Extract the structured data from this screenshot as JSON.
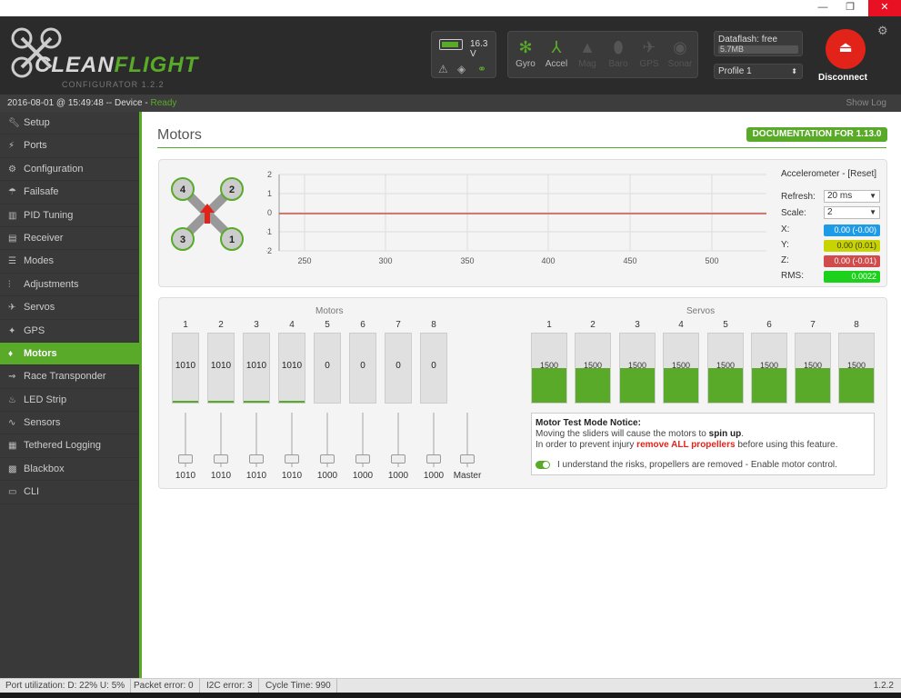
{
  "window": {
    "minimize": "—",
    "restore": "❐",
    "close": "✕"
  },
  "header": {
    "logo": "CLEANFLIGHT",
    "logo_green": "FLIGHT",
    "logo_white": "CLEAN",
    "subtitle": "CONFIGURATOR  1.2.2",
    "voltage": "16.3 V",
    "sensors": [
      {
        "label": "Gyro",
        "icon": "gyro-icon",
        "on": true
      },
      {
        "label": "Accel",
        "icon": "accel-icon",
        "on": true
      },
      {
        "label": "Mag",
        "icon": "mag-icon",
        "on": false
      },
      {
        "label": "Baro",
        "icon": "baro-icon",
        "on": false
      },
      {
        "label": "GPS",
        "icon": "gps-icon",
        "on": false
      },
      {
        "label": "Sonar",
        "icon": "sonar-icon",
        "on": false
      }
    ],
    "dataflash_label": "Dataflash: free",
    "dataflash_size": "5.7MB",
    "profile": "Profile 1",
    "disconnect": "Disconnect"
  },
  "status": {
    "datetime": "2016-08-01 @ 15:49:48 -- Device - ",
    "state": "Ready",
    "show_log": "Show Log"
  },
  "nav": [
    {
      "label": "Setup",
      "icon": "wrench-icon"
    },
    {
      "label": "Ports",
      "icon": "plug-icon"
    },
    {
      "label": "Configuration",
      "icon": "gear-icon"
    },
    {
      "label": "Failsafe",
      "icon": "parachute-icon"
    },
    {
      "label": "PID Tuning",
      "icon": "pid-icon"
    },
    {
      "label": "Receiver",
      "icon": "receiver-icon"
    },
    {
      "label": "Modes",
      "icon": "modes-icon"
    },
    {
      "label": "Adjustments",
      "icon": "sliders-icon"
    },
    {
      "label": "Servos",
      "icon": "servo-icon"
    },
    {
      "label": "GPS",
      "icon": "satellite-icon"
    },
    {
      "label": "Motors",
      "icon": "motor-icon",
      "active": true
    },
    {
      "label": "Race Transponder",
      "icon": "transponder-icon"
    },
    {
      "label": "LED Strip",
      "icon": "led-icon"
    },
    {
      "label": "Sensors",
      "icon": "sensors-icon"
    },
    {
      "label": "Tethered Logging",
      "icon": "logging-icon"
    },
    {
      "label": "Blackbox",
      "icon": "blackbox-icon"
    },
    {
      "label": "CLI",
      "icon": "cli-icon"
    }
  ],
  "main": {
    "title": "Motors",
    "doc_button": "DOCUMENTATION FOR 1.13.0"
  },
  "quad": {
    "motors": [
      "4",
      "2",
      "3",
      "1"
    ]
  },
  "graph": {
    "yticks": [
      "2",
      "1",
      "0",
      "-1",
      "-2"
    ],
    "xticks": [
      "250",
      "300",
      "350",
      "400",
      "450",
      "500"
    ]
  },
  "accel": {
    "title": "Accelerometer - [Reset]",
    "refresh_label": "Refresh:",
    "refresh_value": "20 ms",
    "scale_label": "Scale:",
    "scale_value": "2",
    "x_label": "X:",
    "x_value": "0.00 (-0.00)",
    "y_label": "Y:",
    "y_value": "0.00 (0.01)",
    "z_label": "Z:",
    "z_value": "0.00 (-0.01)",
    "rms_label": "RMS:",
    "rms_value": "0.0022",
    "colors": {
      "x": "#1e9be6",
      "y": "#c8d400",
      "z": "#d04b4b",
      "rms": "#1bd11b"
    }
  },
  "motors": {
    "title": "Motors",
    "numbers": [
      "1",
      "2",
      "3",
      "4",
      "5",
      "6",
      "7",
      "8"
    ],
    "bar_values": [
      "1010",
      "1010",
      "1010",
      "1010",
      "0",
      "0",
      "0",
      "0"
    ],
    "slider_values": [
      "1010",
      "1010",
      "1010",
      "1010",
      "1000",
      "1000",
      "1000",
      "1000"
    ],
    "master_label": "Master"
  },
  "servos": {
    "title": "Servos",
    "numbers": [
      "1",
      "2",
      "3",
      "4",
      "5",
      "6",
      "7",
      "8"
    ],
    "values": [
      "1500",
      "1500",
      "1500",
      "1500",
      "1500",
      "1500",
      "1500",
      "1500"
    ]
  },
  "notice": {
    "title": "Motor Test Mode Notice:",
    "line1_a": "Moving the sliders will cause the motors to ",
    "line1_b": "spin up",
    "line1_c": ".",
    "line2_a": "In order to prevent injury ",
    "line2_b": "remove ALL propellers",
    "line2_c": " before using this feature.",
    "toggle_label": "I understand the risks, propellers are removed - Enable motor control."
  },
  "footer": {
    "port": "Port utilization: D: 22% U: 5%",
    "packet": "Packet error: 0",
    "i2c": "I2C error: 3",
    "cycle": "Cycle Time: 990",
    "version": "1.2.2"
  }
}
